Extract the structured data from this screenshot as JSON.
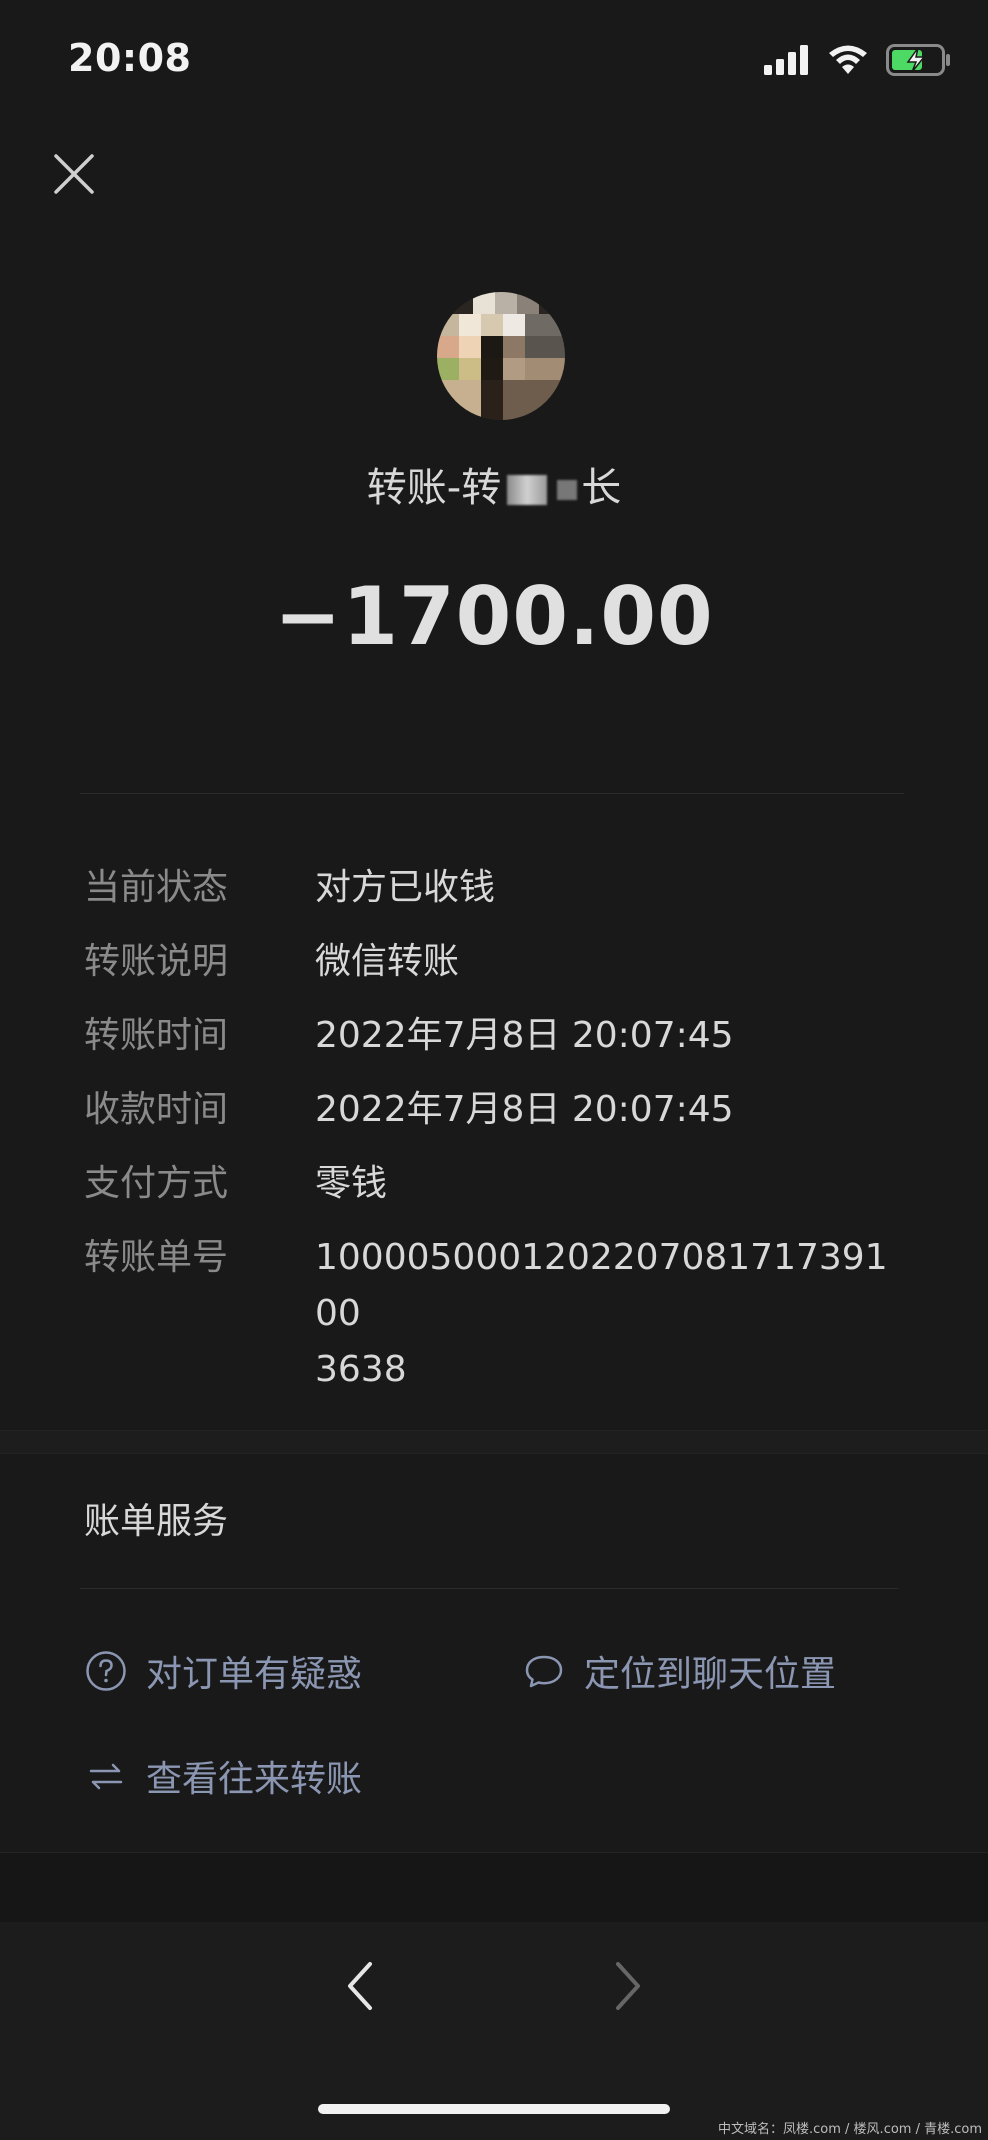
{
  "status_bar": {
    "time": "20:08",
    "icons": [
      "signal-icon",
      "wifi-icon",
      "battery-charging-icon"
    ]
  },
  "header": {
    "close_icon": "close-icon"
  },
  "payee": {
    "title_prefix": "转账-转",
    "title_suffix": "长"
  },
  "amount": "−1700.00",
  "details": [
    {
      "label": "当前状态",
      "value": "对方已收钱"
    },
    {
      "label": "转账说明",
      "value": "微信转账"
    },
    {
      "label": "转账时间",
      "value": "2022年7月8日 20:07:45"
    },
    {
      "label": "收款时间",
      "value": "2022年7月8日 20:07:45"
    },
    {
      "label": "支付方式",
      "value": "零钱"
    },
    {
      "label": "转账单号",
      "value": "100005000120220708171739100\n3638"
    }
  ],
  "services": {
    "title": "账单服务",
    "items": [
      {
        "label": "对订单有疑惑",
        "icon": "question-circle-icon"
      },
      {
        "label": "定位到聊天位置",
        "icon": "chat-bubble-icon"
      },
      {
        "label": "查看往来转账",
        "icon": "swap-arrows-icon"
      }
    ]
  },
  "nav": {
    "back_icon": "chevron-left-icon",
    "forward_icon": "chevron-right-icon"
  },
  "watermark": "中文域名：凤楼.com / 楼风.com / 青楼.com",
  "colors": {
    "background": "#191919",
    "link": "#8b97b2",
    "label": "#8a8a8a",
    "text": "#d8d8d8",
    "battery_charging": "#4cd964"
  }
}
